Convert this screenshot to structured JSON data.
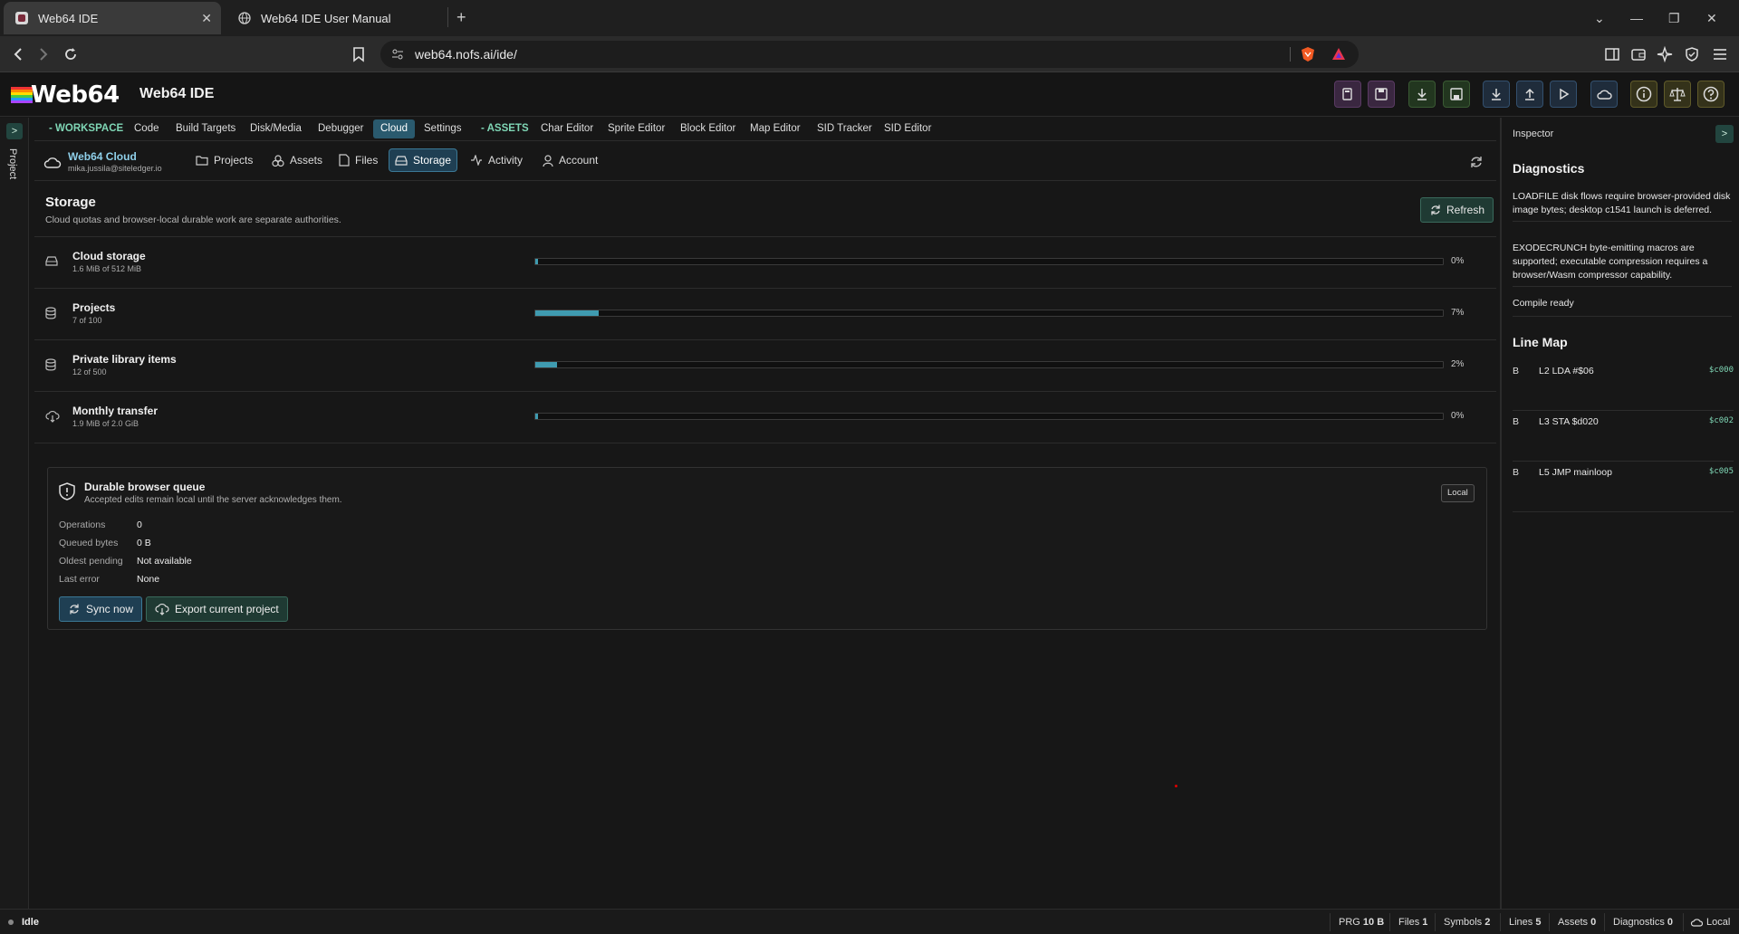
{
  "browser": {
    "tabs": [
      {
        "title": "Web64 IDE",
        "active": true
      },
      {
        "title": "Web64 IDE User Manual",
        "active": false
      }
    ],
    "new_tab": "+",
    "url": "web64.nofs.ai/ide/"
  },
  "app": {
    "logo": "Web64",
    "title": "Web64 IDE"
  },
  "rail": {
    "toggle": ">",
    "label": "Project"
  },
  "menu": {
    "workspace_label": "- WORKSPACE",
    "workspace_items": [
      "Code",
      "Build Targets",
      "Disk/Media",
      "Debugger",
      "Cloud",
      "Settings"
    ],
    "assets_label": "- ASSETS",
    "assets_items": [
      "Char Editor",
      "Sprite Editor",
      "Block Editor",
      "Map Editor",
      "SID Tracker",
      "SID Editor"
    ],
    "active": "Cloud"
  },
  "cloud": {
    "name": "Web64 Cloud",
    "email": "mika.jussila@siteledger.io",
    "tabs": [
      "Projects",
      "Assets",
      "Files",
      "Storage",
      "Activity",
      "Account"
    ],
    "active_tab": "Storage"
  },
  "storage": {
    "title": "Storage",
    "subtitle": "Cloud quotas and browser-local durable work are separate authorities.",
    "refresh_label": "Refresh",
    "rows": [
      {
        "name": "Cloud storage",
        "detail": "1.6 MiB of 512 MiB",
        "percent_label": "0%",
        "fraction": 0.003
      },
      {
        "name": "Projects",
        "detail": "7 of 100",
        "percent_label": "7%",
        "fraction": 0.07
      },
      {
        "name": "Private library items",
        "detail": "12 of 500",
        "percent_label": "2%",
        "fraction": 0.024
      },
      {
        "name": "Monthly transfer",
        "detail": "1.9 MiB of 2.0 GiB",
        "percent_label": "0%",
        "fraction": 0.001
      }
    ]
  },
  "queue": {
    "title": "Durable browser queue",
    "subtitle": "Accepted edits remain local until the server acknowledges them.",
    "badge": "Local",
    "fields": [
      {
        "label": "Operations",
        "value": "0"
      },
      {
        "label": "Queued bytes",
        "value": "0 B"
      },
      {
        "label": "Oldest pending",
        "value": "Not available"
      },
      {
        "label": "Last error",
        "value": "None"
      }
    ],
    "sync_label": "Sync now",
    "export_label": "Export current project"
  },
  "inspector": {
    "title": "Inspector",
    "toggle": ">",
    "diagnostics_title": "Diagnostics",
    "diagnostics": [
      "LOADFILE disk flows require browser-provided disk image bytes; desktop c1541 launch is deferred.",
      "EXODECRUNCH byte-emitting macros are supported; executable compression requires a browser/Wasm compressor capability.",
      "Compile ready"
    ],
    "linemap_title": "Line Map",
    "linemap": [
      {
        "kind": "B",
        "text": "L2 LDA #$06",
        "addr": "$c000"
      },
      {
        "kind": "B",
        "text": "L3 STA $d020",
        "addr": "$c002"
      },
      {
        "kind": "B",
        "text": "L5 JMP mainloop",
        "addr": "$c005"
      }
    ]
  },
  "status": {
    "state": "Idle",
    "items": [
      {
        "label": "PRG",
        "value": "10 B"
      },
      {
        "label": "Files",
        "value": "1"
      },
      {
        "label": "Symbols",
        "value": "2"
      },
      {
        "label": "Lines",
        "value": "5"
      },
      {
        "label": "Assets",
        "value": "0"
      },
      {
        "label": "Diagnostics",
        "value": "0"
      }
    ],
    "mode": "Local"
  },
  "colors": {
    "accent": "#3f9bb0",
    "section": "#7fd6b5",
    "active_tab": "#2a5a6e"
  }
}
